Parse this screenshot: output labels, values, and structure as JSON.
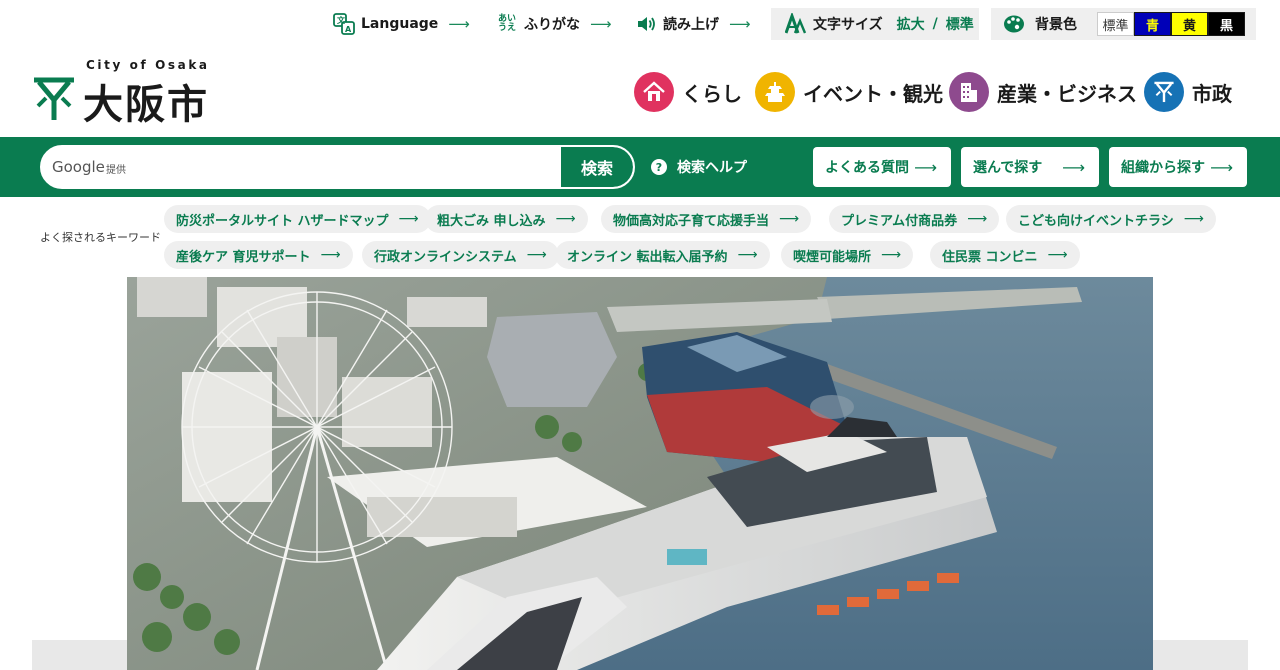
{
  "utility": {
    "language": "Language",
    "furigana": "ふりがな",
    "furigana_icon": [
      "あい",
      "うえ"
    ],
    "read_aloud": "読み上げ",
    "font_size": {
      "label": "文字サイズ",
      "enlarge": "拡大",
      "standard": "標準",
      "separator": "/"
    },
    "background": {
      "label": "背景色",
      "options": [
        "標準",
        "青",
        "黄",
        "黒"
      ]
    },
    "arrow": "⟶"
  },
  "logo": {
    "en": "City of Osaka",
    "jp": "大阪市"
  },
  "main_nav": [
    {
      "label": "くらし",
      "color": "#e0325f",
      "icon": "house-icon"
    },
    {
      "label": "イベント・観光",
      "color": "#f0b400",
      "icon": "castle-icon"
    },
    {
      "label": "産業・ビジネス",
      "color": "#8e4a8e",
      "icon": "building-icon"
    },
    {
      "label": "市政",
      "color": "#1672b5",
      "icon": "city-emblem-icon"
    }
  ],
  "search": {
    "google_label": "Google",
    "provided": "提供",
    "placeholder": "",
    "button": "検索",
    "help": "検索ヘルプ",
    "help_icon": "?"
  },
  "quick_links": [
    "よくある質問",
    "選んで探す",
    "組織から探す"
  ],
  "keywords": {
    "label": "よく探されるキーワード",
    "row1": [
      "防災ポータルサイト ハザードマップ",
      "粗大ごみ 申し込み",
      "物価高対応子育て応援手当",
      "プレミアム付商品券",
      "こども向けイベントチラシ"
    ],
    "row2": [
      "産後ケア 育児サポート",
      "行政オンラインシステム",
      "オンライン 転出転入届予約",
      "喫煙可能場所",
      "住民票 コンビニ"
    ]
  },
  "colors": {
    "brand_green": "#0a7c50"
  }
}
